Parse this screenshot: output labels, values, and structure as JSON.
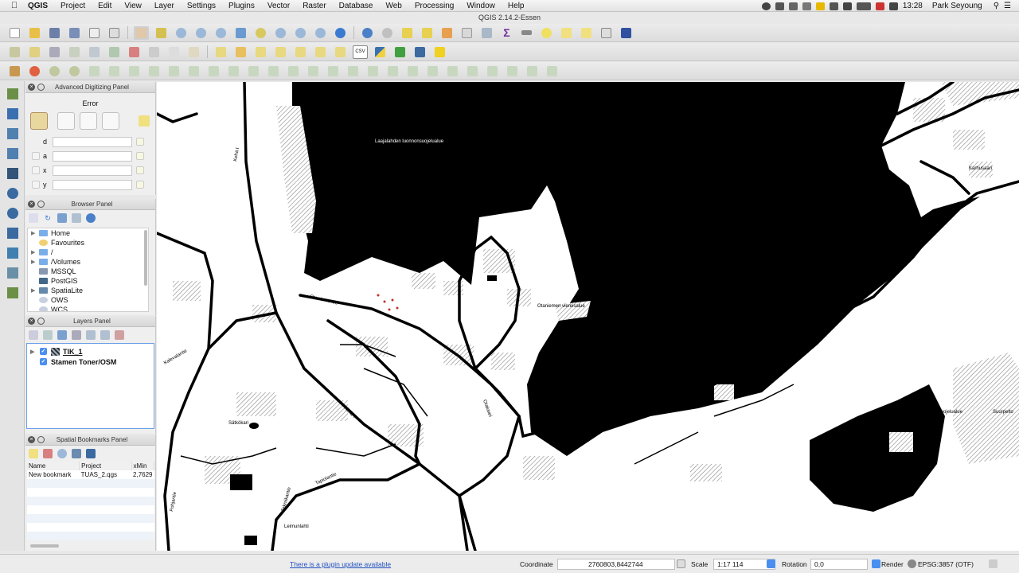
{
  "menubar": {
    "app": "QGIS",
    "items": [
      "Project",
      "Edit",
      "View",
      "Layer",
      "Settings",
      "Plugins",
      "Vector",
      "Raster",
      "Database",
      "Web",
      "Processing",
      "Window",
      "Help"
    ],
    "time": "13:28",
    "user": "Park Seyoung"
  },
  "window": {
    "title": "QGIS 2.14.2-Essen"
  },
  "advanced_digitizing": {
    "title": "Advanced Digitizing Panel",
    "error": "Error",
    "fields": [
      {
        "label": "d",
        "value": ""
      },
      {
        "label": "a",
        "value": ""
      },
      {
        "label": "x",
        "value": ""
      },
      {
        "label": "y",
        "value": ""
      }
    ]
  },
  "browser": {
    "title": "Browser Panel",
    "items": [
      {
        "label": "Home",
        "icon": "folder-icon",
        "expandable": true
      },
      {
        "label": "Favourites",
        "icon": "star-icon",
        "expandable": false
      },
      {
        "label": "/",
        "icon": "folder-icon",
        "expandable": true
      },
      {
        "label": "/Volumes",
        "icon": "folder-icon",
        "expandable": true
      },
      {
        "label": "MSSQL",
        "icon": "database-icon",
        "expandable": false
      },
      {
        "label": "PostGIS",
        "icon": "elephant-icon",
        "expandable": false
      },
      {
        "label": "SpatiaLite",
        "icon": "spatialite-icon",
        "expandable": true
      },
      {
        "label": "OWS",
        "icon": "globe-icon",
        "expandable": false
      },
      {
        "label": "WCS",
        "icon": "globe-icon",
        "expandable": false
      }
    ]
  },
  "layers": {
    "title": "Layers Panel",
    "items": [
      {
        "label": "TIK_1",
        "checked": true,
        "expandable": true
      },
      {
        "label": "Stamen Toner/OSM",
        "checked": true,
        "expandable": false
      }
    ]
  },
  "bookmarks": {
    "title": "Spatial Bookmarks Panel",
    "columns": [
      "Name",
      "Project",
      "xMin"
    ],
    "rows": [
      [
        "New bookmark",
        "TUAS_2.qgs",
        "2,7629"
      ]
    ]
  },
  "map": {
    "labels": [
      "Laajalahden luonnonsuojelualue",
      "Otaniemen viereisalue",
      "Karhusaari",
      "Vanhankartanon luonnonsuojelualue",
      "Suurpelto",
      "Otaniementie",
      "Kehä I",
      "Kuusisaarentie",
      "Tapiolantie",
      "Leimunlahti",
      "Otakaari",
      "Pikkusaarentie",
      "Kalevalantie",
      "Sätkökari",
      "Kehä I",
      "Pohjantie",
      "Tekniikantie"
    ]
  },
  "statusbar": {
    "plugin_update": "There is a plugin update available",
    "coordinate_label": "Coordinate",
    "coordinate": "2760803,8442744",
    "scale_label": "Scale",
    "scale": "1:17 114",
    "rotation_label": "Rotation",
    "rotation": "0,0",
    "render_label": "Render",
    "crs": "EPSG:3857 (OTF)"
  },
  "colors": {
    "accent": "#4a8ef0",
    "map_water": "#000000",
    "map_land": "#ffffff",
    "link": "#2050c0"
  }
}
